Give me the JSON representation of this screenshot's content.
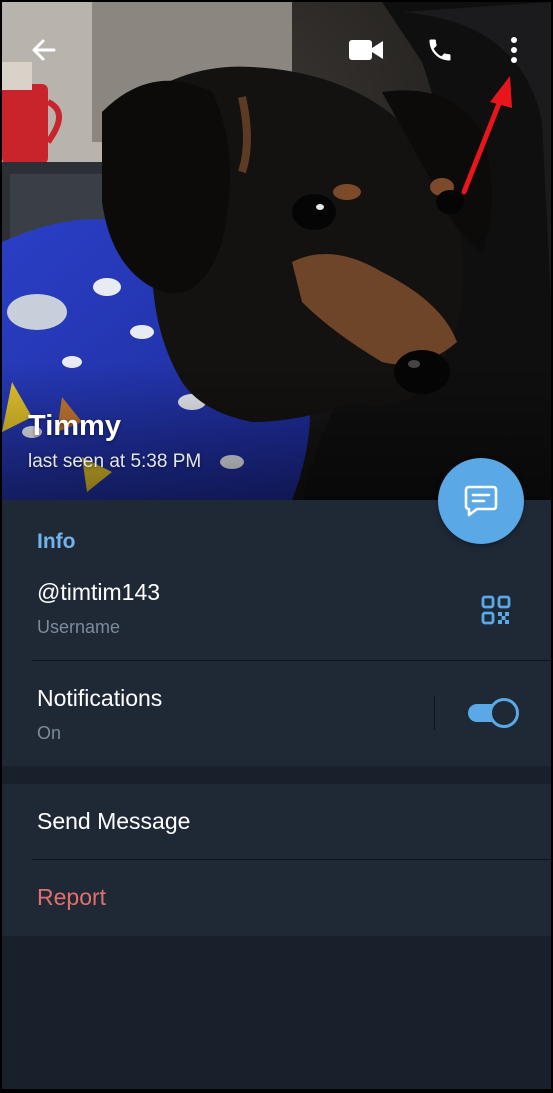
{
  "profile": {
    "name": "Timmy",
    "status": "last seen at 5:38 PM"
  },
  "topbar": {
    "back_icon": "arrow-left-icon",
    "video_icon": "video-camera-icon",
    "call_icon": "phone-icon",
    "more_icon": "more-vertical-icon"
  },
  "info": {
    "section_title": "Info",
    "username": {
      "value": "@timtim143",
      "label": "Username",
      "icon": "qr-code-icon"
    },
    "notifications": {
      "label": "Notifications",
      "value": "On",
      "enabled": true
    }
  },
  "actions": {
    "send_message": "Send Message",
    "report": "Report"
  },
  "fab": {
    "icon": "message-icon"
  },
  "colors": {
    "accent": "#5aa8e6",
    "section_title": "#71b3ea",
    "report": "#e0706d",
    "background": "#18202b",
    "surface": "#1f2936",
    "annotation_arrow": "#e8161b"
  }
}
